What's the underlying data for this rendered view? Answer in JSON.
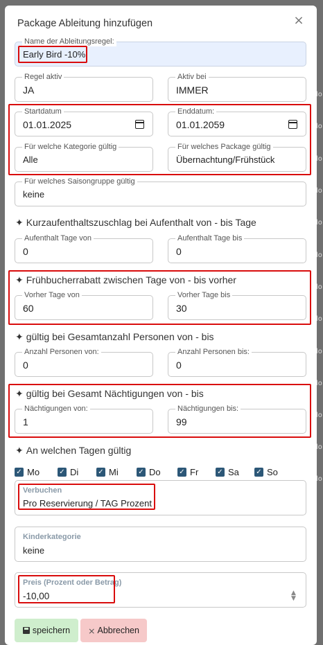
{
  "modal": {
    "title": "Package Ableitung hinzufügen",
    "close_glyph": "×"
  },
  "background_right_glyph": "lo",
  "fields": {
    "name": {
      "label": "Name der Ableitungsregel:",
      "value": "Early Bird -10%"
    },
    "rule_active": {
      "label": "Regel aktiv",
      "value": "JA"
    },
    "active_at": {
      "label": "Aktiv bei",
      "value": "IMMER"
    },
    "start_date": {
      "label": "Startdatum",
      "value": "01.01.2025"
    },
    "end_date": {
      "label": "Enddatum:",
      "value": "01.01.2059"
    },
    "category": {
      "label": "Für welche Kategorie gültig",
      "value": "Alle"
    },
    "package": {
      "label": "Für welches Package gültig",
      "value": "Übernachtung/Frühstück"
    },
    "season_group": {
      "label": "Für welches Saisongruppe gültig",
      "value": "keine"
    }
  },
  "sections": {
    "short_stay": {
      "title": "Kurzaufenthaltszuschlag bei Aufenthalt von - bis Tage",
      "from": {
        "label": "Aufenthalt Tage von",
        "value": "0"
      },
      "to": {
        "label": "Aufenthalt Tage bis",
        "value": "0"
      }
    },
    "early_booking": {
      "title": "Frühbucherrabatt zwischen Tage von - bis vorher",
      "from": {
        "label": "Vorher Tage von",
        "value": "60"
      },
      "to": {
        "label": "Vorher Tage bis",
        "value": "30"
      }
    },
    "persons": {
      "title": "gültig bei Gesamtanzahl Personen von - bis",
      "from": {
        "label": "Anzahl Personen von:",
        "value": "0"
      },
      "to": {
        "label": "Anzahl Personen bis:",
        "value": "0"
      }
    },
    "nights": {
      "title": "gültig bei Gesamt Nächtigungen von - bis",
      "from": {
        "label": "Nächtigungen von:",
        "value": "1"
      },
      "to": {
        "label": "Nächtigungen bis:",
        "value": "99"
      }
    },
    "days": {
      "title": "An welchen Tagen gültig"
    }
  },
  "weekdays": [
    {
      "label": "Mo",
      "checked": true
    },
    {
      "label": "Di",
      "checked": true
    },
    {
      "label": "Mi",
      "checked": true
    },
    {
      "label": "Do",
      "checked": true
    },
    {
      "label": "Fr",
      "checked": true
    },
    {
      "label": "Sa",
      "checked": true
    },
    {
      "label": "So",
      "checked": true
    }
  ],
  "booking": {
    "label": "Verbuchen",
    "value": "Pro Reservierung / TAG Prozent"
  },
  "child_category": {
    "label": "Kinderkategorie",
    "value": "keine"
  },
  "price": {
    "label": "Preis (Prozent oder Betrag)",
    "value": "-10,00"
  },
  "buttons": {
    "save": "speichern",
    "cancel": "Abbrechen"
  },
  "icons": {
    "sparkle": "✦",
    "check": "✓",
    "save": "floppy-disk-icon",
    "cancel": "×"
  },
  "colors": {
    "highlight": "#d90c0c",
    "checkbox": "#2c5777",
    "save_bg": "#cfeecd",
    "cancel_bg": "#f6c9c9"
  }
}
